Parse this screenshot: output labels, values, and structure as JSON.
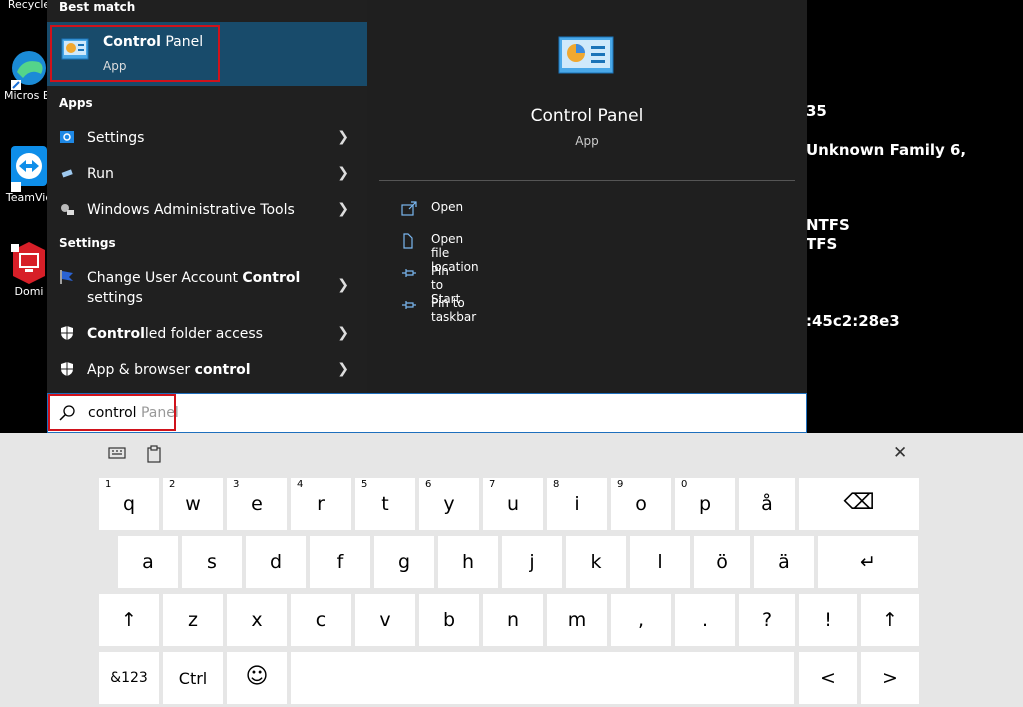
{
  "desktop": {
    "icons": [
      {
        "label": "Recycle",
        "icon": "recycle-bin-icon"
      },
      {
        "label": "Micros Edge",
        "icon": "edge-icon"
      },
      {
        "label": "TeamVie",
        "icon": "teamviewer-icon"
      },
      {
        "label": "Domi",
        "icon": "domain-icon"
      }
    ],
    "sysinfo": [
      "35",
      "Unknown Family 6,",
      "NTFS",
      "TFS",
      ":45c2:28e3"
    ]
  },
  "start": {
    "best_match_header": "Best match",
    "best_match": {
      "title_bold": "Control",
      "title_rest": " Panel",
      "subtitle": "App"
    },
    "apps_header": "Apps",
    "apps": [
      {
        "label": "Settings",
        "icon": "settings-icon"
      },
      {
        "label": "Run",
        "icon": "run-icon"
      },
      {
        "label": "Windows Administrative Tools",
        "icon": "admin-tools-icon"
      }
    ],
    "settings_header": "Settings",
    "settings": [
      {
        "pre": "Change User Account ",
        "bold": "Control",
        "post": "",
        "line2": "settings",
        "icon": "uac-flag-icon"
      },
      {
        "pre": "",
        "bold": "Control",
        "post": "led folder access",
        "icon": "shield-icon"
      },
      {
        "pre": "App & browser ",
        "bold": "control",
        "post": "",
        "icon": "shield-icon"
      }
    ]
  },
  "preview": {
    "title": "Control Panel",
    "subtitle": "App",
    "actions": [
      {
        "label": "Open",
        "icon": "open-icon"
      },
      {
        "label": "Open file location",
        "icon": "file-location-icon"
      },
      {
        "label": "Pin to Start",
        "icon": "pin-icon"
      },
      {
        "label": "Pin to taskbar",
        "icon": "pin-icon"
      }
    ]
  },
  "search": {
    "typed": "control",
    "suggestion": "Panel"
  },
  "keyboard": {
    "row1": [
      [
        "1",
        "q"
      ],
      [
        "2",
        "w"
      ],
      [
        "3",
        "e"
      ],
      [
        "4",
        "r"
      ],
      [
        "5",
        "t"
      ],
      [
        "6",
        "y"
      ],
      [
        "7",
        "u"
      ],
      [
        "8",
        "i"
      ],
      [
        "9",
        "o"
      ],
      [
        "0",
        "p"
      ],
      [
        "",
        "å"
      ]
    ],
    "row2": [
      "a",
      "s",
      "d",
      "f",
      "g",
      "h",
      "j",
      "k",
      "l",
      "ö",
      "ä"
    ],
    "row3": [
      "z",
      "x",
      "c",
      "v",
      "b",
      "n",
      "m",
      ",",
      ".",
      "?",
      "!"
    ],
    "row4": {
      "sym": "&123",
      "ctrl": "Ctrl"
    },
    "glyphs": {
      "backspace": "⌫",
      "enter": "↵",
      "shift": "↑",
      "left": "<",
      "right": ">",
      "close": "✕",
      "emoji": "☺"
    }
  }
}
